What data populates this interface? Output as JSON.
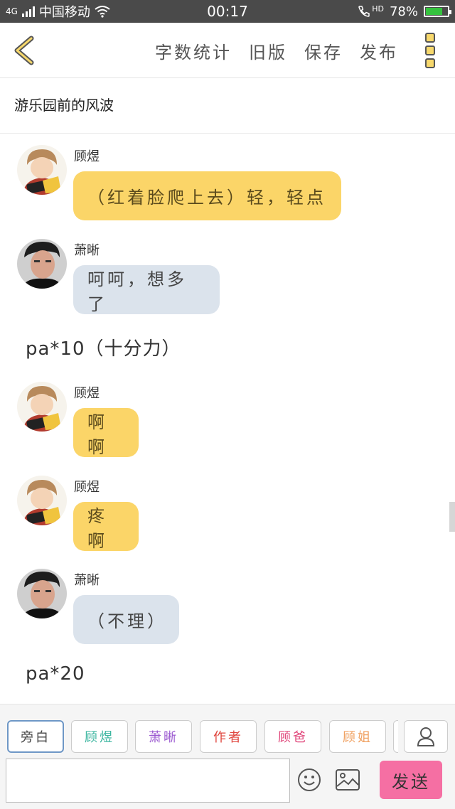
{
  "status_bar": {
    "network": "4G",
    "carrier": "中国移动",
    "time": "00:17",
    "hd": "HD",
    "battery": "78%",
    "battery_level": 0.78
  },
  "header": {
    "actions": [
      "字数统计",
      "旧版",
      "保存",
      "发布"
    ]
  },
  "story": {
    "title": "游乐园前的风波"
  },
  "messages": [
    {
      "type": "bubble",
      "sender": "顾煜",
      "text": "（红着脸爬上去）轻，轻点",
      "color": "yellow"
    },
    {
      "type": "bubble",
      "sender": "萧晰",
      "text": "呵呵，想多了",
      "color": "grey"
    },
    {
      "type": "narration",
      "text": "pa*10（十分力）"
    },
    {
      "type": "bubble",
      "sender": "顾煜",
      "text": "啊啊",
      "color": "yellow"
    },
    {
      "type": "bubble",
      "sender": "顾煜",
      "text": "疼啊",
      "color": "yellow"
    },
    {
      "type": "bubble",
      "sender": "萧晰",
      "text": "（不理）",
      "color": "grey"
    },
    {
      "type": "narration",
      "text": "pa*20"
    }
  ],
  "role_tabs": [
    {
      "label": "旁白",
      "color": "#444444"
    },
    {
      "label": "顾煜",
      "color": "#3cb6a0"
    },
    {
      "label": "萧晰",
      "color": "#9b59d0"
    },
    {
      "label": "作者",
      "color": "#e0463e"
    },
    {
      "label": "顾爸",
      "color": "#e0467a"
    },
    {
      "label": "顾姐",
      "color": "#f0a060"
    }
  ],
  "composer": {
    "input_value": "",
    "send_label": "发送"
  }
}
